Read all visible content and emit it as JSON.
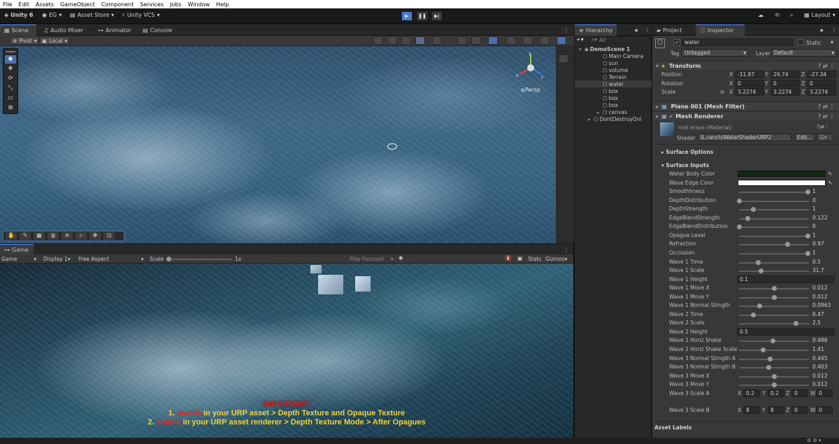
{
  "menu": [
    "File",
    "Edit",
    "Assets",
    "GameObject",
    "Component",
    "Services",
    "Jobs",
    "Window",
    "Help"
  ],
  "toolbar": {
    "unity_version": "Unity 6",
    "account": "EG",
    "asset_store": "Asset Store",
    "vcs": "Unity VCS",
    "layout": "Layout"
  },
  "scene_tabs": [
    "Scene",
    "Audio Mixer",
    "Animator",
    "Console"
  ],
  "scene_bar": {
    "pivot": "Pivot",
    "local": "Local"
  },
  "persp_label": "≤Persp",
  "game_tab": "Game",
  "game_bar": {
    "mode": "Game",
    "display": "Display 1",
    "aspect": "Free Aspect",
    "scale_label": "Scale",
    "scale_value": "1x",
    "play_focused": "Play Focused",
    "stats": "Stats",
    "gizmos": "Gizmos"
  },
  "notice": {
    "title": "IMPORTANT!",
    "line1": {
      "num": "1.",
      "enable": "enable",
      "rest": "in your URP asset > Depth Texture and Opaque Texture"
    },
    "line2": {
      "num": "2.",
      "enable": "enable",
      "rest": "in your URP asset renderer > Depth Texture Mode > After Opagues"
    }
  },
  "hierarchy": {
    "tab": "Hierarchy",
    "search": "All",
    "items": [
      {
        "name": "DemoScene 1",
        "depth": 0
      },
      {
        "name": "Main Camera",
        "depth": 2
      },
      {
        "name": "sun",
        "depth": 2
      },
      {
        "name": "volume",
        "depth": 2
      },
      {
        "name": "Terrain",
        "depth": 2
      },
      {
        "name": "water",
        "depth": 2
      },
      {
        "name": "box",
        "depth": 2
      },
      {
        "name": "box",
        "depth": 2
      },
      {
        "name": "box",
        "depth": 2
      },
      {
        "name": "canvas",
        "depth": 2
      },
      {
        "name": "DontDestroyOnl",
        "depth": 1
      }
    ]
  },
  "inspector": {
    "tabs": [
      "Project",
      "Inspector"
    ],
    "object_name": "water",
    "static_label": "Static",
    "tag_label": "Tag",
    "tag_value": "Untagged",
    "layer_label": "Layer",
    "layer_value": "Default",
    "transform": {
      "title": "Transform",
      "rows": [
        {
          "label": "Position",
          "x": "-11.87",
          "y": "29.74",
          "z": "-27.34"
        },
        {
          "label": "Rotation",
          "x": "0",
          "y": "0",
          "z": "0"
        },
        {
          "label": "Scale",
          "x": "3.2274",
          "y": "3.2274",
          "z": "3.2274"
        }
      ]
    },
    "mesh_filter": "Plane 001 (Mesh Filter)",
    "mesh_renderer": "Mesh Renderer",
    "material_name": "mat erase (Material)",
    "shader_label": "Shader",
    "shader_value": "IL.ranch/WaterShaderURP2",
    "edit_label": "Edit...",
    "surface_options": "Surface Options",
    "surface_inputs": "Surface Inputs",
    "colors": [
      {
        "label": "Water Body Color",
        "hex": "#0f2a12"
      },
      {
        "label": "Wave Edge Color",
        "hex": "#ffffff"
      }
    ],
    "sliders": [
      {
        "label": "Smoothhness",
        "value": "1",
        "frac": 1.0
      },
      {
        "label": "DepthDistribution",
        "value": "0",
        "frac": 0.0
      },
      {
        "label": "DepthStrength",
        "value": "1",
        "frac": 0.2
      },
      {
        "label": "EdgeBlendStrength",
        "value": "0.122",
        "frac": 0.12
      },
      {
        "label": "EdgeBlendDistribution",
        "value": "0",
        "frac": 0.0
      },
      {
        "label": "Opague Level",
        "value": "1",
        "frac": 1.0
      },
      {
        "label": "Refraction",
        "value": "0.97",
        "frac": 0.7
      },
      {
        "label": "Occlusion",
        "value": "1",
        "frac": 1.0
      },
      {
        "label": "Wave 1 Time",
        "value": "0.5",
        "frac": 0.28
      },
      {
        "label": "Wave 1 Scale",
        "value": "31.7",
        "frac": 0.32
      },
      {
        "label": "Wave 1 Height",
        "value": "0.1",
        "frac": null
      },
      {
        "label": "Wave 1 Move X",
        "value": "0.012",
        "frac": 0.51
      },
      {
        "label": "Wave 1 Move Y",
        "value": "0.012",
        "frac": 0.51
      },
      {
        "label": "Wave 1 Normal Strngth",
        "value": "0.0963",
        "frac": 0.3
      },
      {
        "label": "Wave 2 Time",
        "value": "0.47",
        "frac": 0.2
      },
      {
        "label": "Wave 2 Scale",
        "value": "2.5",
        "frac": 0.83
      },
      {
        "label": "Wave 2 Height",
        "value": "0.5",
        "frac": null
      },
      {
        "label": "Wave 2 Horiz Shake",
        "value": "0.486",
        "frac": 0.49
      },
      {
        "label": "Wave 2 Horiz Shake Scale",
        "value": "1.41",
        "frac": 0.35
      },
      {
        "label": "Wave 3 Normal Strngth A",
        "value": "0.445",
        "frac": 0.45
      },
      {
        "label": "Wave 3 Normal Strngth B",
        "value": "0.403",
        "frac": 0.43
      },
      {
        "label": "Wave 3 Move X",
        "value": "0.012",
        "frac": 0.51
      },
      {
        "label": "Wave 3 Move Y",
        "value": "0.012",
        "frac": 0.51
      }
    ],
    "vec4": [
      {
        "label": "Wave 3 Scale A",
        "x": "0.2",
        "y": "0.2",
        "z": "0",
        "w": "0"
      },
      {
        "label": "Wave 3 Scale B",
        "x": "8",
        "y": "8",
        "z": "0",
        "w": "0"
      }
    ],
    "asset_labels": "Asset Labels"
  }
}
